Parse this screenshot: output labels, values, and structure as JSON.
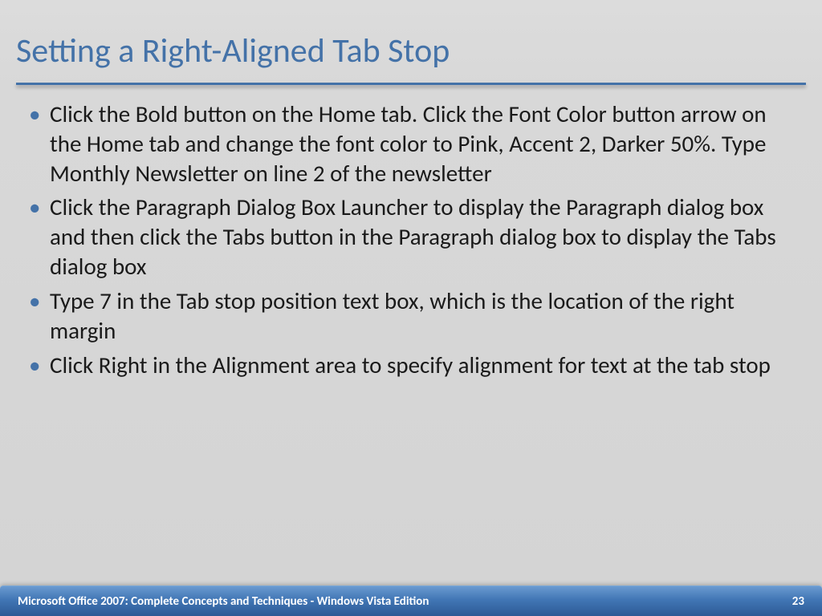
{
  "title": "Setting a Right-Aligned Tab Stop",
  "bullets": [
    "Click the Bold button on the Home tab. Click the Font Color button arrow on the Home tab and change the font color to Pink, Accent 2, Darker 50%. Type Monthly Newsletter on line 2 of the newsletter",
    "Click the Paragraph Dialog Box Launcher to display the Paragraph dialog box and then click the Tabs button in the Paragraph dialog box to display the Tabs dialog box",
    "Type 7 in the Tab stop position text box, which is the location of the right margin",
    "Click Right in the Alignment area to specify alignment for text at the tab stop"
  ],
  "footer": {
    "text": "Microsoft Office 2007: Complete Concepts and Techniques - Windows Vista Edition",
    "page": "23"
  }
}
